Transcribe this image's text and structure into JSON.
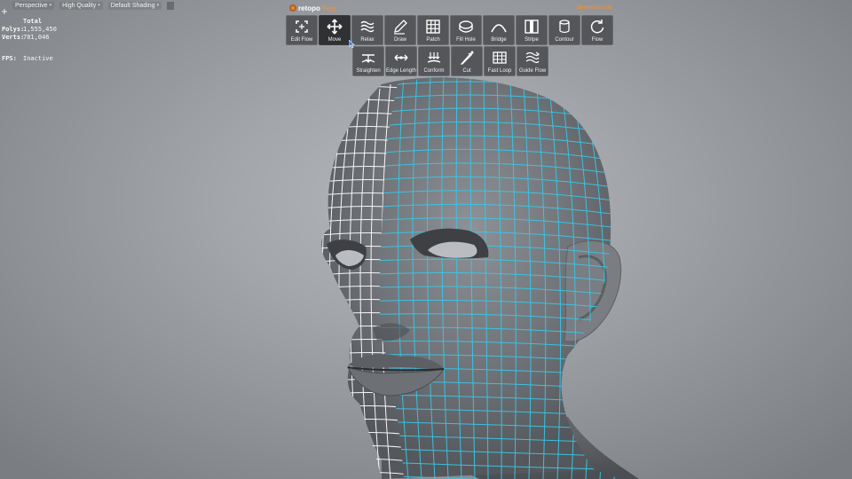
{
  "viewport_menu": {
    "view": "Perspective",
    "quality": "High Quality",
    "shading": "Default Shading"
  },
  "stats": {
    "header": "Total",
    "polys_label": "Polys:",
    "polys_value": "1,555,450",
    "verts_label": "Verts:",
    "verts_value": "781,046",
    "fps_label": "FPS:",
    "fps_value": "Inactive"
  },
  "panel": {
    "logo_a": "retopo",
    "logo_b": "flow",
    "shortcuts": "Shortcuts List",
    "tools_row1": [
      {
        "label": "Edit Flow",
        "icon": "edit-flow-icon"
      },
      {
        "label": "Move",
        "icon": "move-icon",
        "active": true
      },
      {
        "label": "Relax",
        "icon": "relax-icon"
      },
      {
        "label": "Draw",
        "icon": "draw-icon"
      },
      {
        "label": "Patch",
        "icon": "patch-icon"
      },
      {
        "label": "Fill Hole",
        "icon": "fill-hole-icon"
      },
      {
        "label": "Bridge",
        "icon": "bridge-icon"
      },
      {
        "label": "Stripe",
        "icon": "stripe-icon"
      },
      {
        "label": "Contour",
        "icon": "contour-icon"
      },
      {
        "label": "Flow",
        "icon": "flow-icon"
      }
    ],
    "tools_row2": [
      {
        "label": "Straighten",
        "icon": "straighten-icon"
      },
      {
        "label": "Edge Length",
        "icon": "edge-length-icon"
      },
      {
        "label": "Conform",
        "icon": "conform-icon"
      },
      {
        "label": "Cut",
        "icon": "cut-icon"
      },
      {
        "label": "Fast Loop",
        "icon": "fast-loop-icon"
      },
      {
        "label": "Guide Flow",
        "icon": "guide-flow-icon"
      }
    ]
  },
  "colors": {
    "accent": "#e8913f",
    "wire_selected": "#38c8e8",
    "wire": "#ffffff",
    "button_bg": "#545659",
    "button_active_bg": "#2f3133"
  }
}
